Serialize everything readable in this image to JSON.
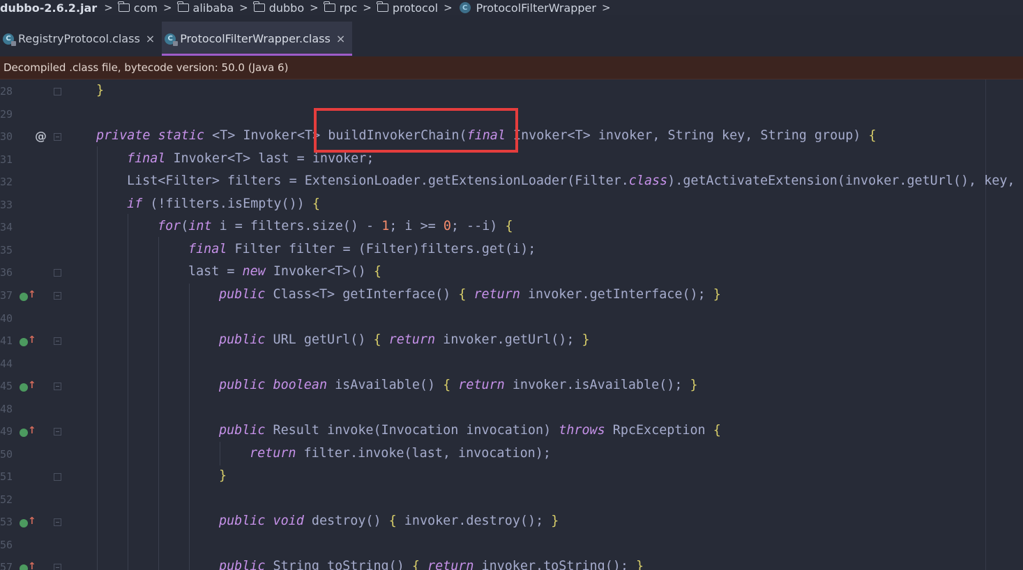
{
  "breadcrumb": {
    "jar": "dubbo-2.6.2.jar",
    "folders": [
      "com",
      "alibaba",
      "dubbo",
      "rpc",
      "protocol"
    ],
    "class": "ProtocolFilterWrapper"
  },
  "tabs": [
    {
      "label": "RegistryProtocol.class",
      "active": false
    },
    {
      "label": "ProtocolFilterWrapper.class",
      "active": true
    }
  ],
  "banner": "Decompiled .class file, bytecode version: 50.0 (Java 6)",
  "gutter_numbers": [
    "28",
    "29",
    "30",
    "31",
    "32",
    "33",
    "34",
    "35",
    "36",
    "37",
    "40",
    "41",
    "44",
    "45",
    "48",
    "49",
    "50",
    "51",
    "52",
    "53",
    "56",
    "57"
  ],
  "code": [
    "}",
    "",
    "private static <T> Invoker<T> buildInvokerChain(final Invoker<T> invoker, String key, String group) {",
    "final Invoker<T> last = invoker;",
    "List<Filter> filters = ExtensionLoader.getExtensionLoader(Filter.class).getActivateExtension(invoker.getUrl(), key, g",
    "if (!filters.isEmpty()) {",
    "for(int i = filters.size() - 1; i >= 0; --i) {",
    "final Filter filter = (Filter)filters.get(i);",
    "last = new Invoker<T>() {",
    "public Class<T> getInterface() { return invoker.getInterface(); }",
    "",
    "public URL getUrl() { return invoker.getUrl(); }",
    "",
    "public boolean isAvailable() { return invoker.isAvailable(); }",
    "",
    "public Result invoke(Invocation invocation) throws RpcException {",
    "return filter.invoke(last, invocation);",
    "}",
    "",
    "public void destroy() { invoker.destroy(); }",
    "",
    "public String toString() { return invoker.toString(); }"
  ],
  "colors": {
    "background": "#272b37",
    "keyword": "#c792ea",
    "number": "#f78c6c",
    "banner_bg": "#3c241f",
    "active_tab_underline": "#a05cc8",
    "highlight_box": "#e43d3d"
  }
}
